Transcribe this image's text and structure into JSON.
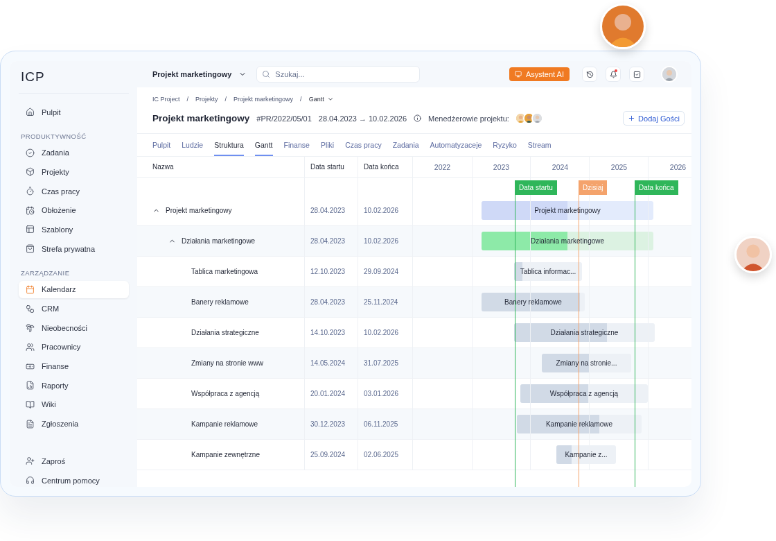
{
  "sidebar": {
    "logo": "ICP",
    "sections": [
      {
        "items": [
          {
            "label": "Pulpit",
            "selected": false
          }
        ]
      },
      {
        "heading": "PRODUKTYWNOŚĆ",
        "items": [
          {
            "label": "Zadania",
            "selected": false
          },
          {
            "label": "Projekty",
            "selected": false
          },
          {
            "label": "Czas pracy",
            "selected": false
          },
          {
            "label": "Obłożenie",
            "selected": false
          },
          {
            "label": "Szablony",
            "selected": false
          },
          {
            "label": "Strefa prywatna",
            "selected": false
          }
        ]
      },
      {
        "heading": "ZARZĄDZANIE",
        "items": [
          {
            "label": "Kalendarz",
            "selected": true
          },
          {
            "label": "CRM",
            "selected": false
          },
          {
            "label": "Nieobecności",
            "selected": false
          },
          {
            "label": "Pracownicy",
            "selected": false
          },
          {
            "label": "Finanse",
            "selected": false
          },
          {
            "label": "Raporty",
            "selected": false
          },
          {
            "label": "Wiki",
            "selected": false
          },
          {
            "label": "Zgłoszenia",
            "selected": false
          }
        ]
      },
      {
        "items": [
          {
            "label": "Zaproś",
            "selected": false
          },
          {
            "label": "Centrum pomocy",
            "selected": false
          }
        ]
      }
    ]
  },
  "topbar": {
    "project_switcher": "Projekt marketingowy",
    "search": {
      "placeholder": "Szukaj..."
    },
    "ai_button": "Asystent AI",
    "notifications_unread": true
  },
  "breadcrumbs": {
    "separator": "/",
    "items": [
      "IC Project",
      "Projekty",
      "Projekt marketingowy",
      "Gantt"
    ]
  },
  "project": {
    "title": "Projekt marketingowy",
    "code": "#PR/2022/05/01",
    "dates": "28.04.2023 → 10.02.2026",
    "managers_label": "Menedżerowie projektu:",
    "add_guest_button": "Dodaj Gości"
  },
  "tabs": [
    {
      "label": "Pulpit",
      "selected": false
    },
    {
      "label": "Ludzie",
      "selected": false
    },
    {
      "label": "Struktura",
      "selected": true
    },
    {
      "label": "Gantt",
      "selected": true
    },
    {
      "label": "Finanse",
      "selected": false
    },
    {
      "label": "Pliki",
      "selected": false
    },
    {
      "label": "Czas pracy",
      "selected": false
    },
    {
      "label": "Zadania",
      "selected": false
    },
    {
      "label": "Automatyzaceje",
      "selected": false
    },
    {
      "label": "Ryzyko",
      "selected": false
    },
    {
      "label": "Stream",
      "selected": false
    }
  ],
  "gantt": {
    "columns": [
      "Nazwa",
      "Data startu",
      "Data końca"
    ],
    "years": [
      "2022",
      "2023",
      "2024",
      "2025",
      "2026"
    ],
    "markers": [
      {
        "label": "Data startu",
        "color": "#2fb65a"
      },
      {
        "label": "Dzisiaj",
        "color": "#f4a36c"
      },
      {
        "label": "Data końca",
        "color": "#2fb65a"
      }
    ],
    "rows": [
      {
        "name": "Projekt marketingowy",
        "start": "28.04.2023",
        "end": "10.02.2026",
        "kind": "project",
        "bar_label": "Projekt marketingowy",
        "level": 0.5,
        "expanded": true,
        "children": [
          {
            "name": "Działania marketingowe",
            "start": "28.04.2023",
            "end": "10.02.2026",
            "kind": "group",
            "bar_label": "Działania marketingowe",
            "level": 0.5,
            "expanded": true,
            "children": [
              {
                "name": "Tablica marketingowa",
                "start": "12.10.2023",
                "end": "29.09.2024",
                "kind": "task",
                "bar_label": "Tablica informac...",
                "level": 0.12
              },
              {
                "name": "Banery reklamowe",
                "start": "28.04.2023",
                "end": "25.11.2024",
                "kind": "task",
                "bar_label": "Banery reklamowe",
                "level": 0.95
              },
              {
                "name": "Działania strategiczne",
                "start": "14.10.2023",
                "end": "10.02.2026",
                "kind": "task",
                "bar_label": "Działania strategiczne",
                "level": 0.66
              },
              {
                "name": "Zmiany na stronie www",
                "start": "14.05.2024",
                "end": "31.07.2025",
                "kind": "task",
                "bar_label": "Zmiany na stronie...",
                "level": 0.53
              },
              {
                "name": "Współpraca z agencją",
                "start": "20.01.2024",
                "end": "03.01.2026",
                "kind": "task",
                "bar_label": "Współpraca z agencją",
                "level": 0.53
              },
              {
                "name": "Kampanie reklamowe",
                "start": "30.12.2023",
                "end": "06.11.2025",
                "kind": "task",
                "bar_label": "Kampanie reklamowe",
                "level": 0.66
              },
              {
                "name": "Kampanie zewnętrzne",
                "start": "25.09.2024",
                "end": "02.06.2025",
                "kind": "task",
                "bar_label": "Kampanie z...",
                "level": 0.26
              }
            ]
          }
        ]
      }
    ]
  }
}
